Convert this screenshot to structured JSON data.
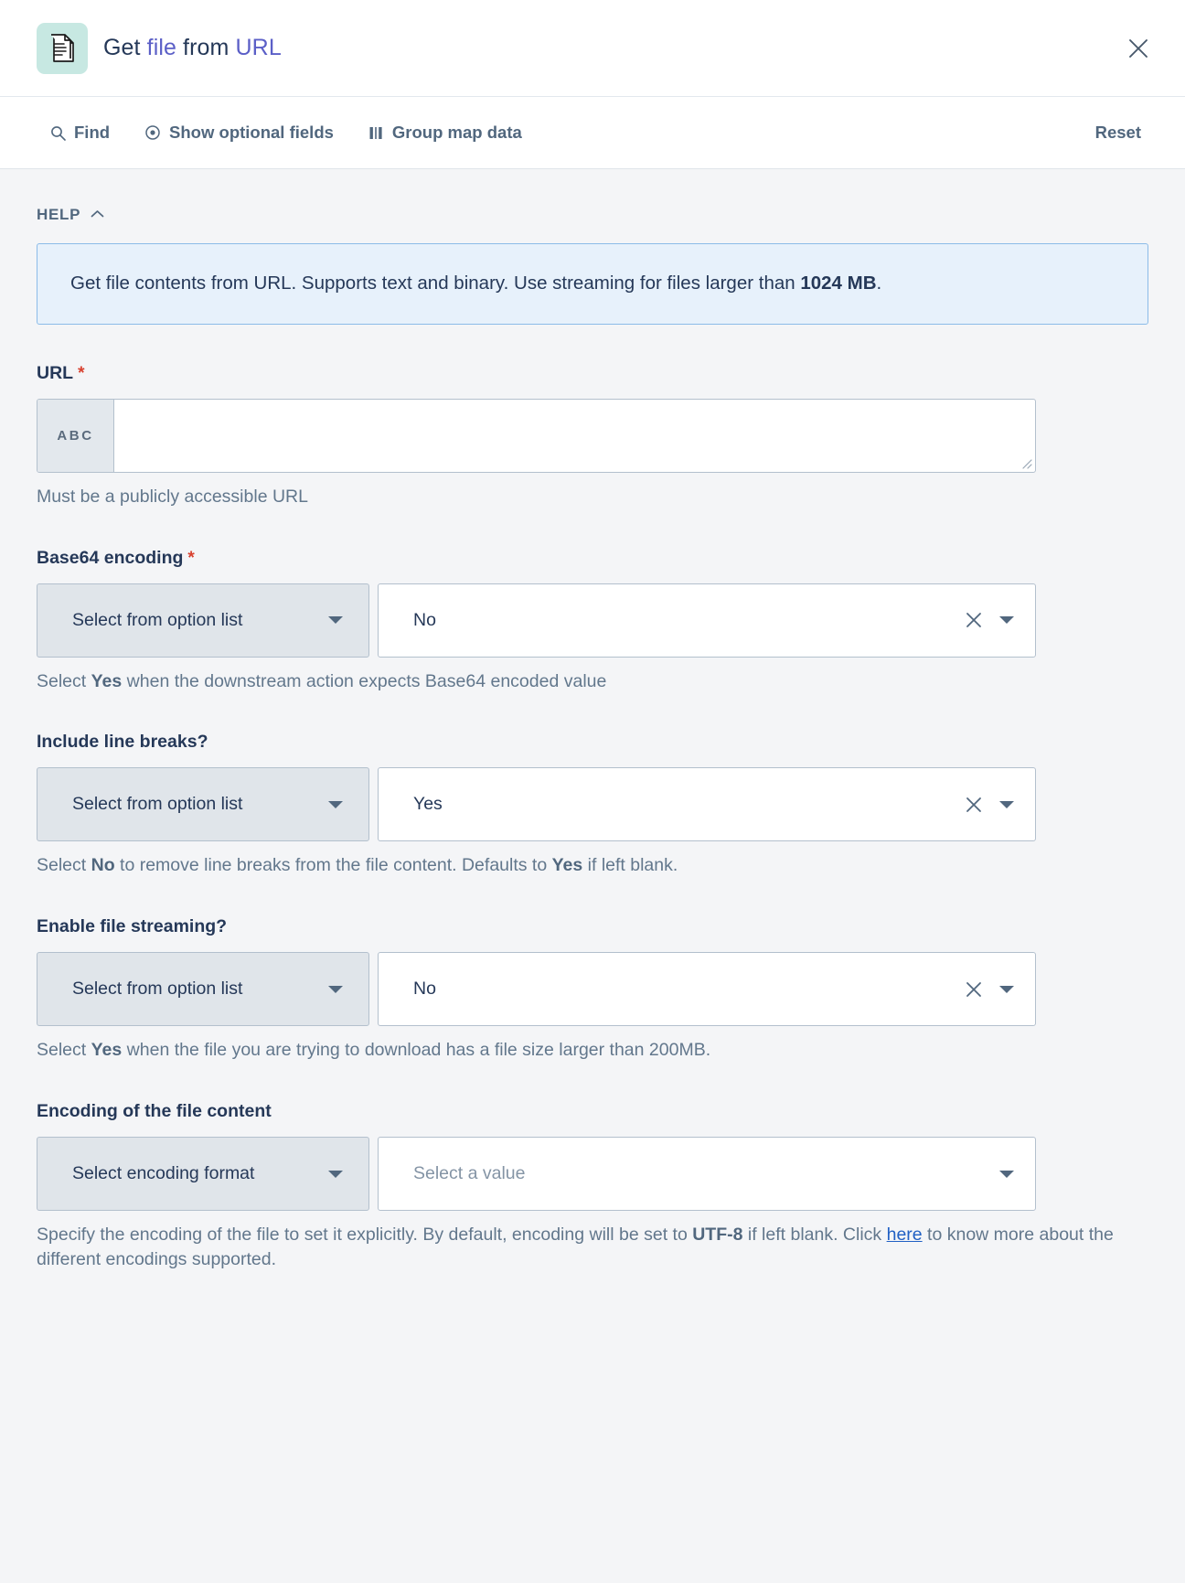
{
  "header": {
    "icon_name": "document-file-icon",
    "title_parts": [
      {
        "text": "Get ",
        "accent": false
      },
      {
        "text": "file",
        "accent": true
      },
      {
        "text": " from ",
        "accent": false
      },
      {
        "text": "URL",
        "accent": true
      }
    ],
    "title_plain": "Get file from URL",
    "close_label": "close-icon"
  },
  "toolbar": {
    "find_label": "Find",
    "show_optional_label": "Show optional fields",
    "group_map_label": "Group map data",
    "reset_label": "Reset"
  },
  "help": {
    "section_label": "HELP",
    "collapse_icon": "chevron-up-icon",
    "text_before": "Get file contents from URL. Supports text and binary. Use streaming for files larger than ",
    "text_bold": "1024 MB",
    "text_after": "."
  },
  "fields": {
    "url": {
      "label": "URL",
      "required": true,
      "prefix_label": "ABC",
      "value": "",
      "placeholder": "",
      "hint": "Must be a publicly accessible URL"
    },
    "base64": {
      "label": "Base64 encoding",
      "required": true,
      "left_select_value": "Select from option list",
      "right_select_value": "No",
      "hint_before": "Select ",
      "hint_bold": "Yes",
      "hint_after": " when the downstream action expects Base64 encoded value"
    },
    "line_breaks": {
      "label": "Include line breaks?",
      "required": false,
      "left_select_value": "Select from option list",
      "right_select_value": "Yes",
      "hint_before": "Select ",
      "hint_bold": "No",
      "hint_mid": " to remove line breaks from the file content. Defaults to ",
      "hint_bold2": "Yes",
      "hint_after": " if left blank."
    },
    "streaming": {
      "label": "Enable file streaming?",
      "required": false,
      "left_select_value": "Select from option list",
      "right_select_value": "No",
      "hint_before": "Select ",
      "hint_bold": "Yes",
      "hint_after": " when the file you are trying to download has a file size larger than 200MB."
    },
    "encoding": {
      "label": "Encoding of the file content",
      "required": false,
      "left_select_value": "Select encoding format",
      "right_select_placeholder": "Select a value",
      "hint_before": "Specify the encoding of the file to set it explicitly. By default, encoding will be set to ",
      "hint_bold": "UTF-8",
      "hint_mid": " if left blank. Click ",
      "hint_link": "here",
      "hint_after": " to know more about the different encodings supported."
    }
  },
  "colors": {
    "accent_blue": "#5b5fc7",
    "help_bg": "#e7f1fb",
    "help_border": "#8cbce8",
    "body_bg": "#f4f5f7",
    "required_red": "#d8412f",
    "icon_tile": "#c7e8e2",
    "link_blue": "#2060c4"
  }
}
